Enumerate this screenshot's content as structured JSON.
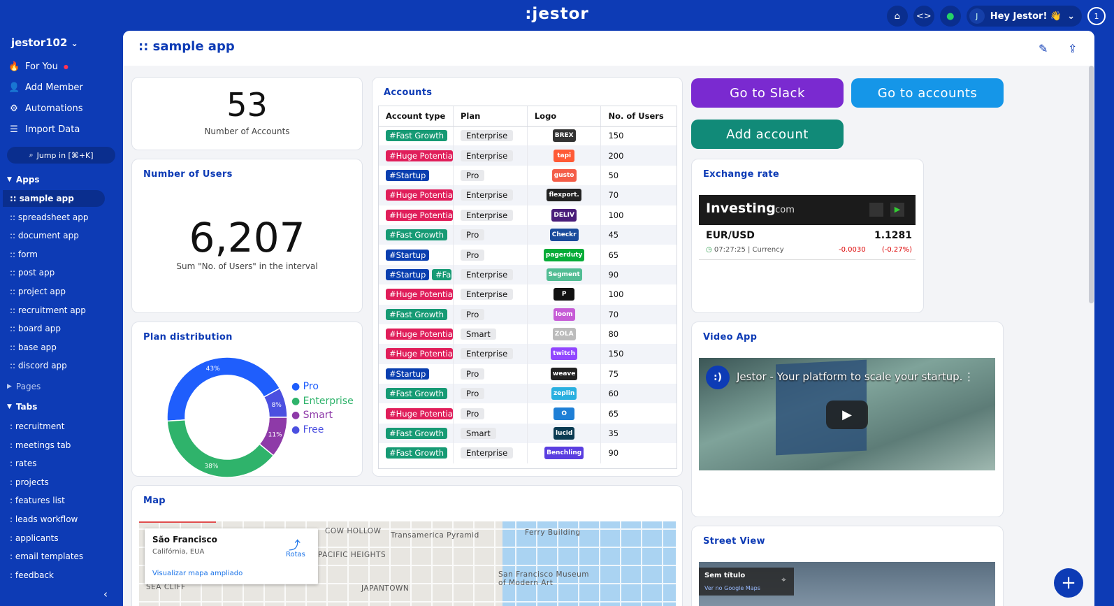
{
  "topbar": {
    "logo": ":jestor",
    "greeting": "Hey Jestor! 👋",
    "avatar_letter": "J",
    "notifications": "1"
  },
  "sidebar": {
    "workspace": "jestor102",
    "nav": [
      {
        "label": "For You",
        "icon": "fire-icon"
      },
      {
        "label": "Add Member",
        "icon": "add-user-icon"
      },
      {
        "label": "Automations",
        "icon": "robot-icon"
      },
      {
        "label": "Import Data",
        "icon": "database-icon"
      }
    ],
    "jump_label": "Jump in [⌘+K]",
    "apps_header": "Apps",
    "apps": [
      ":: sample app",
      ":: spreadsheet app",
      ":: document app",
      ":: form",
      ":: post app",
      ":: project app",
      ":: recruitment app",
      ":: board app",
      ":: base app",
      ":: discord app"
    ],
    "pages_header": "Pages",
    "tabs_header": "Tabs",
    "tabs": [
      ": recruitment",
      ": meetings tab",
      ": rates",
      ": projects",
      ": features list",
      ": leads workflow",
      ": applicants",
      ": email templates",
      ": feedback"
    ]
  },
  "page": {
    "title": ":: sample app"
  },
  "kpi1": {
    "value": "53",
    "label": "Number of Accounts"
  },
  "kpi2": {
    "title": "Number of Users",
    "value": "6,207",
    "label": "Sum \"No. of Users\" in the interval"
  },
  "plan": {
    "title": "Plan distribution",
    "legend": [
      "Pro",
      "Enterprise",
      "Smart",
      "Free"
    ]
  },
  "chart_data": {
    "type": "pie",
    "categories": [
      "Pro",
      "Enterprise",
      "Smart",
      "Free"
    ],
    "values": [
      43,
      38,
      11,
      8
    ],
    "labels": [
      "43%",
      "38%",
      "11%",
      "8%"
    ],
    "colors": [
      "#1f5efc",
      "#2fb36b",
      "#8e3aa8",
      "#4b50e0"
    ]
  },
  "accounts": {
    "title": "Accounts",
    "columns": [
      "Account type",
      "Plan",
      "Logo",
      "No. of Users"
    ],
    "rows": [
      {
        "type": "#Fast Growth",
        "color": "#169a74",
        "plan": "Enterprise",
        "logo": "BREX",
        "logo_color": "#333",
        "users": "150"
      },
      {
        "type": "#Huge Potential",
        "color": "#e01e5a",
        "plan": "Enterprise",
        "logo": "tapi",
        "logo_color": "#ff5a36",
        "users": "200"
      },
      {
        "type": "#Startup",
        "color": "#0a3fb0",
        "plan": "Pro",
        "logo": "gusto",
        "logo_color": "#f45d48",
        "users": "50"
      },
      {
        "type": "#Huge Potential",
        "color": "#e01e5a",
        "plan": "Enterprise",
        "logo": "flexport.",
        "logo_color": "#222",
        "users": "70"
      },
      {
        "type": "#Huge Potential",
        "color": "#e01e5a",
        "plan": "Enterprise",
        "logo": "DELIV",
        "logo_color": "#4a1d7a",
        "users": "100"
      },
      {
        "type": "#Fast Growth",
        "color": "#169a74",
        "plan": "Pro",
        "logo": "Checkr",
        "logo_color": "#1a4b9c",
        "users": "45"
      },
      {
        "type": "#Startup",
        "color": "#0a3fb0",
        "plan": "Pro",
        "logo": "pagerduty",
        "logo_color": "#06ac38",
        "users": "65"
      },
      {
        "type": "#Startup",
        "color": "#0a3fb0",
        "plan": "Enterprise",
        "logo": "Segment",
        "logo_color": "#52bd94",
        "users": "90",
        "extra": "#Fa"
      },
      {
        "type": "#Huge Potential",
        "color": "#e01e5a",
        "plan": "Enterprise",
        "logo": "P",
        "logo_color": "#111",
        "users": "100"
      },
      {
        "type": "#Fast Growth",
        "color": "#169a74",
        "plan": "Pro",
        "logo": "loom",
        "logo_color": "#c65bd6",
        "users": "70"
      },
      {
        "type": "#Huge Potential",
        "color": "#e01e5a",
        "plan": "Smart",
        "logo": "ZOLA",
        "logo_color": "#bbb",
        "users": "80"
      },
      {
        "type": "#Huge Potential",
        "color": "#e01e5a",
        "plan": "Enterprise",
        "logo": "twitch",
        "logo_color": "#9146ff",
        "users": "150"
      },
      {
        "type": "#Startup",
        "color": "#0a3fb0",
        "plan": "Pro",
        "logo": "weave",
        "logo_color": "#222",
        "users": "75"
      },
      {
        "type": "#Fast Growth",
        "color": "#169a74",
        "plan": "Pro",
        "logo": "zeplin",
        "logo_color": "#2ab0e0",
        "users": "60"
      },
      {
        "type": "#Huge Potential",
        "color": "#e01e5a",
        "plan": "Pro",
        "logo": "O",
        "logo_color": "#1e7fd6",
        "users": "65"
      },
      {
        "type": "#Fast Growth",
        "color": "#169a74",
        "plan": "Smart",
        "logo": "lucid",
        "logo_color": "#0b3b52",
        "users": "35"
      },
      {
        "type": "#Fast Growth",
        "color": "#169a74",
        "plan": "Enterprise",
        "logo": "Benchling",
        "logo_color": "#5a3ee0",
        "users": "90"
      }
    ]
  },
  "buttons": {
    "slack": "Go to Slack",
    "accounts": "Go to accounts",
    "add": "Add account"
  },
  "exchange": {
    "title": "Exchange rate",
    "brand": "Investing",
    "brand_suffix": ".com",
    "pair": "EUR/USD",
    "rate": "1.1281",
    "time": "07:27:25 | Currency",
    "change": "-0.0030",
    "pct": "(-0.27%)"
  },
  "video": {
    "title": "Video App",
    "caption": "Jestor - Your platform to scale your startup."
  },
  "map": {
    "title": "Map",
    "place": "São Francisco",
    "region": "Califórnia, EUA",
    "directions": "Rotas",
    "link": "Visualizar mapa ampliado",
    "labels": [
      "COW HOLLOW",
      "Transamerica Pyramid",
      "Ferry Building",
      "PACIFIC HEIGHTS",
      "San Francisco Museum",
      "of Modern Art",
      "JAPANTOWN",
      "SEA CLIFF"
    ]
  },
  "street": {
    "title": "Street View",
    "caption": "Sem título",
    "subcaption": "Ver no Google Maps"
  }
}
